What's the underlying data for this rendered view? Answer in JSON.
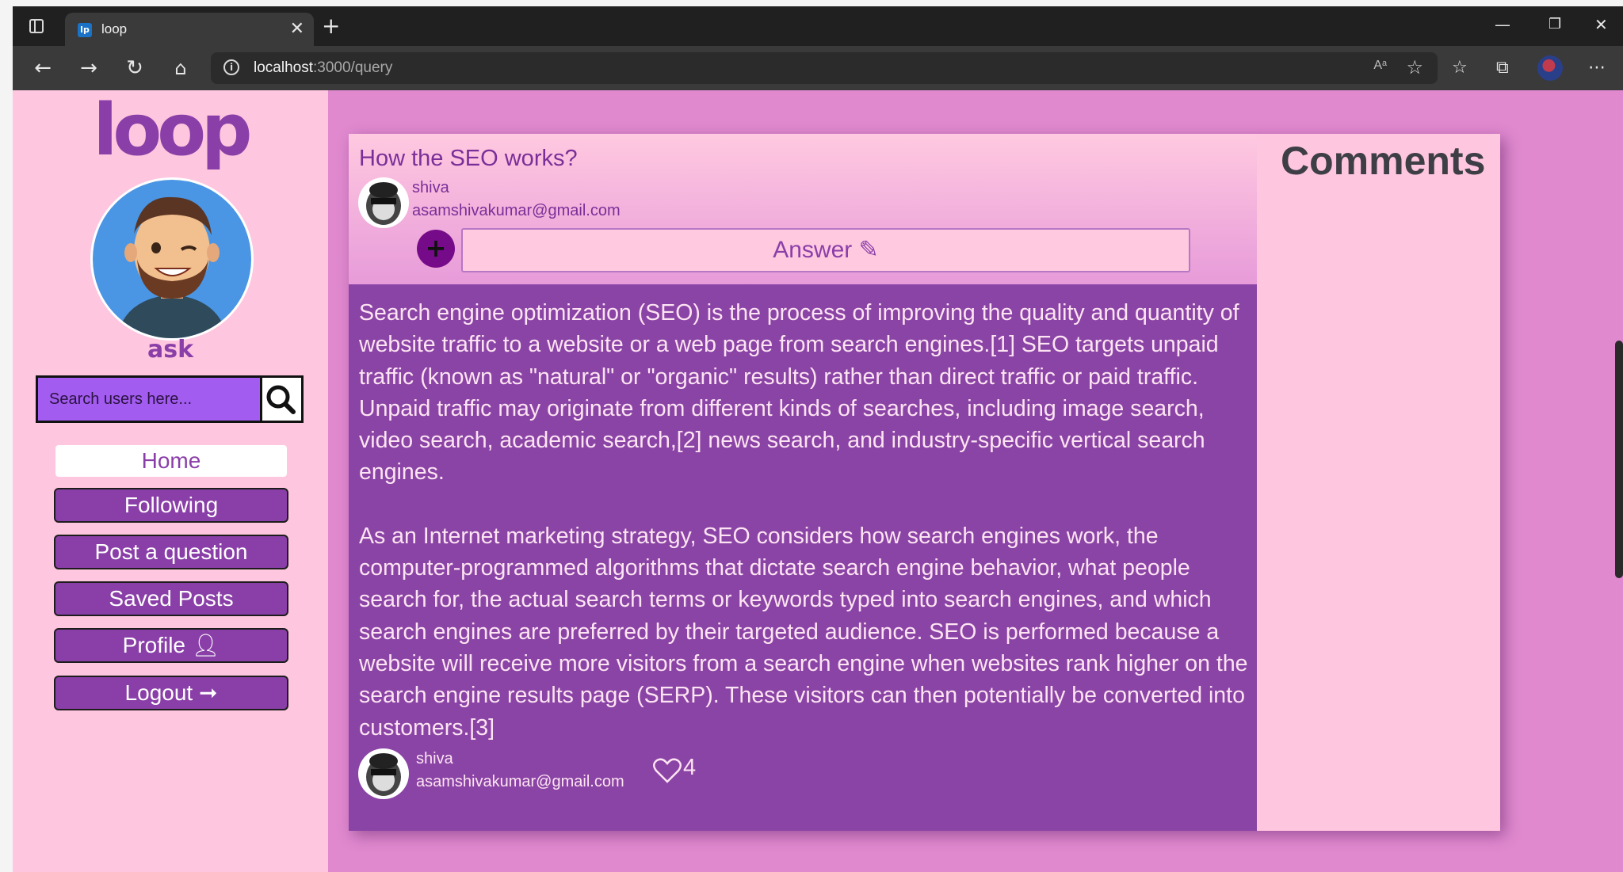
{
  "browser": {
    "tab_title": "loop",
    "favicon_text": "lp",
    "new_tab": "+",
    "url_host": "localhost",
    "url_path": ":3000/query",
    "read_aloud": "Aᵃ",
    "win_min": "—",
    "win_max": "❐",
    "win_close": "✕"
  },
  "sidebar": {
    "logo": "loop",
    "tagline": "ask",
    "search_placeholder": "Search users here...",
    "nav": {
      "home": "Home",
      "following": "Following",
      "post_question": "Post a question",
      "saved_posts": "Saved Posts",
      "profile": "Profile",
      "logout": "Logout"
    }
  },
  "question": {
    "title": "How the SEO works?",
    "author": {
      "name": "shiva",
      "email": "asamshivakumar@gmail.com"
    },
    "answer_label": "Answer",
    "add_label": "+"
  },
  "answer": {
    "paragraphs": [
      " Search engine optimization (SEO) is the process of improving the quality and quantity of website traffic to a website or a web page from search engines.[1] SEO targets unpaid traffic (known as \"natural\" or \"organic\" results) rather than direct traffic or paid traffic. Unpaid traffic may originate from different kinds of searches, including image search, video search, academic search,[2] news search, and industry-specific vertical search engines.",
      "As an Internet marketing strategy, SEO considers how search engines work, the computer-programmed algorithms that dictate search engine behavior, what people search for, the actual search terms or keywords typed into search engines, and which search engines are preferred by their targeted audience. SEO is performed because a website will receive more visitors from a search engine when websites rank higher on the search engine results page (SERP). These visitors can then potentially be converted into customers.[3]"
    ],
    "author": {
      "name": "shiva",
      "email": "asamshivakumar@gmail.com"
    },
    "likes": "4"
  },
  "comments": {
    "heading": "Comments"
  }
}
